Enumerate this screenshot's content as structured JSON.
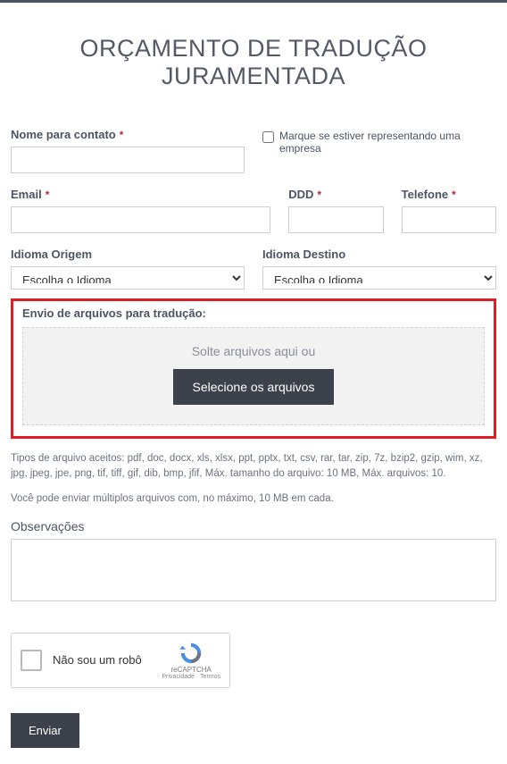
{
  "title": "ORÇAMENTO DE TRADUÇÃO JURAMENTADA",
  "fields": {
    "contact_name": {
      "label": "Nome para contato",
      "value": ""
    },
    "company_checkbox": {
      "label": "Marque se estiver representando uma empresa"
    },
    "email": {
      "label": "Email",
      "value": ""
    },
    "ddd": {
      "label": "DDD",
      "value": ""
    },
    "phone": {
      "label": "Telefone",
      "value": ""
    },
    "origin_lang": {
      "label": "Idioma Origem",
      "selected": "Escolha o Idioma"
    },
    "dest_lang": {
      "label": "Idioma Destino",
      "selected": "Escolha o Idioma"
    }
  },
  "upload": {
    "section_label": "Envio de arquivos para tradução:",
    "drop_text": "Solte arquivos aqui ou",
    "button": "Selecione os arquivos"
  },
  "helpers": {
    "accepted": "Tipos de arquivo aceitos: pdf, doc, docx, xls, xlsx, ppt, pptx, txt, csv, rar, tar, zip, 7z, bzip2, gzip, wim, xz, jpg, jpeg, jpe, png, tif, tiff, gif, dib, bmp, jfif, Máx. tamanho do arquivo: 10 MB, Máx. arquivos: 10.",
    "multi": "Você pode enviar múltiplos arquivos com, no máximo, 10 MB em cada."
  },
  "observations": {
    "label": "Observações",
    "value": ""
  },
  "recaptcha": {
    "label": "Não sou um robô",
    "brand": "reCAPTCHA",
    "privacy": "Privacidade · Termos"
  },
  "submit": "Enviar"
}
